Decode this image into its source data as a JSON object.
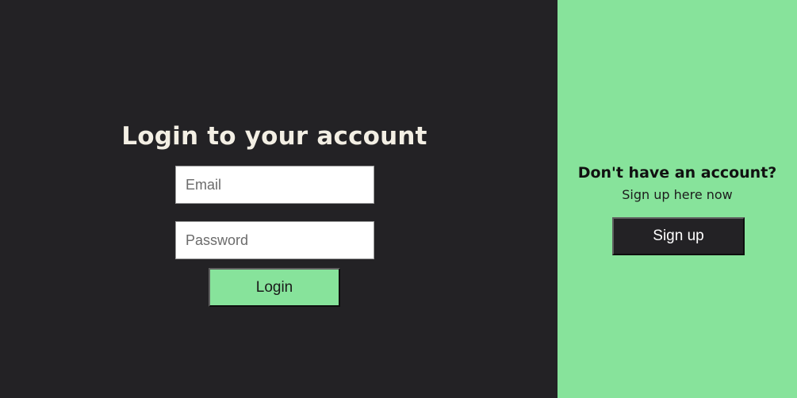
{
  "login": {
    "title": "Login to your account",
    "email_placeholder": "Email",
    "password_placeholder": "Password",
    "button_label": "Login"
  },
  "signup": {
    "title": "Don't have an account?",
    "subtitle": "Sign up here now",
    "button_label": "Sign up"
  },
  "colors": {
    "dark_background": "#232225",
    "accent_green": "#87e39b",
    "title_text": "#f3efe4"
  }
}
